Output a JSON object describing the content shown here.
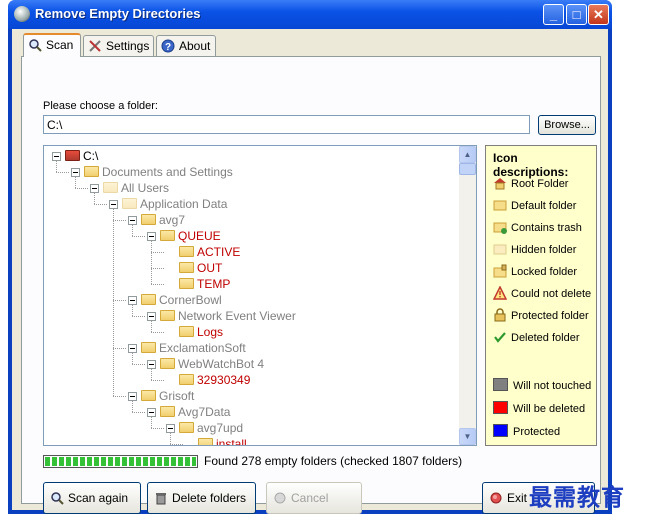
{
  "window": {
    "title": "Remove Empty Directories",
    "app_icon": "app-icon"
  },
  "tabs": [
    {
      "label": "Scan",
      "icon": "search-icon",
      "active": true
    },
    {
      "label": "Settings",
      "icon": "tools-icon",
      "active": false
    },
    {
      "label": "About",
      "icon": "help-icon",
      "active": false
    }
  ],
  "scan": {
    "folder_label": "Please choose a folder:",
    "folder_value": "C:\\",
    "browse_label": "Browse..."
  },
  "tree": {
    "nodes": [
      {
        "label": "C:\\",
        "state": "root",
        "color": "#000000"
      },
      {
        "label": "Documents and Settings",
        "state": "default",
        "color": "#808080"
      },
      {
        "label": "All Users",
        "state": "hidden",
        "color": "#808080"
      },
      {
        "label": "Application Data",
        "state": "hidden",
        "color": "#808080"
      },
      {
        "label": "avg7",
        "state": "default",
        "color": "#808080"
      },
      {
        "label": "QUEUE",
        "state": "deleted",
        "color": "#c00000"
      },
      {
        "label": "ACTIVE",
        "state": "deleted",
        "color": "#c00000"
      },
      {
        "label": "OUT",
        "state": "deleted",
        "color": "#c00000"
      },
      {
        "label": "TEMP",
        "state": "deleted",
        "color": "#c00000"
      },
      {
        "label": "CornerBowl",
        "state": "default",
        "color": "#808080"
      },
      {
        "label": "Network Event Viewer",
        "state": "default",
        "color": "#808080"
      },
      {
        "label": "Logs",
        "state": "deleted",
        "color": "#c00000"
      },
      {
        "label": "ExclamationSoft",
        "state": "default",
        "color": "#808080"
      },
      {
        "label": "WebWatchBot 4",
        "state": "default",
        "color": "#808080"
      },
      {
        "label": "32930349",
        "state": "deleted",
        "color": "#c00000"
      },
      {
        "label": "Grisoft",
        "state": "default",
        "color": "#808080"
      },
      {
        "label": "Avg7Data",
        "state": "default",
        "color": "#808080"
      },
      {
        "label": "avg7upd",
        "state": "default",
        "color": "#808080"
      },
      {
        "label": "install",
        "state": "deleted",
        "color": "#c00000"
      }
    ]
  },
  "legend": {
    "title": "Icon descriptions:",
    "icons": [
      {
        "label": "Root Folder",
        "icon": "root-folder-icon"
      },
      {
        "label": "Default folder",
        "icon": "default-folder-icon"
      },
      {
        "label": "Contains trash",
        "icon": "trash-folder-icon"
      },
      {
        "label": "Hidden folder",
        "icon": "hidden-folder-icon"
      },
      {
        "label": "Locked folder",
        "icon": "locked-folder-icon"
      },
      {
        "label": "Could not delete",
        "icon": "warning-icon"
      },
      {
        "label": "Protected folder",
        "icon": "protected-folder-icon"
      },
      {
        "label": "Deleted folder",
        "icon": "checkmark-icon"
      }
    ],
    "colors": [
      {
        "label": "Will not touched",
        "color": "#808080"
      },
      {
        "label": "Will be deleted",
        "color": "#ff0000"
      },
      {
        "label": "Protected",
        "color": "#0000ff"
      }
    ]
  },
  "status": {
    "progress_fraction": 1.0,
    "text": "Found 278 empty folders (checked 1807 folders)"
  },
  "buttons": {
    "scan_again": "Scan again",
    "delete_folders": "Delete folders",
    "cancel": "Cancel",
    "exit": "Exit"
  },
  "watermark": "最需教育"
}
